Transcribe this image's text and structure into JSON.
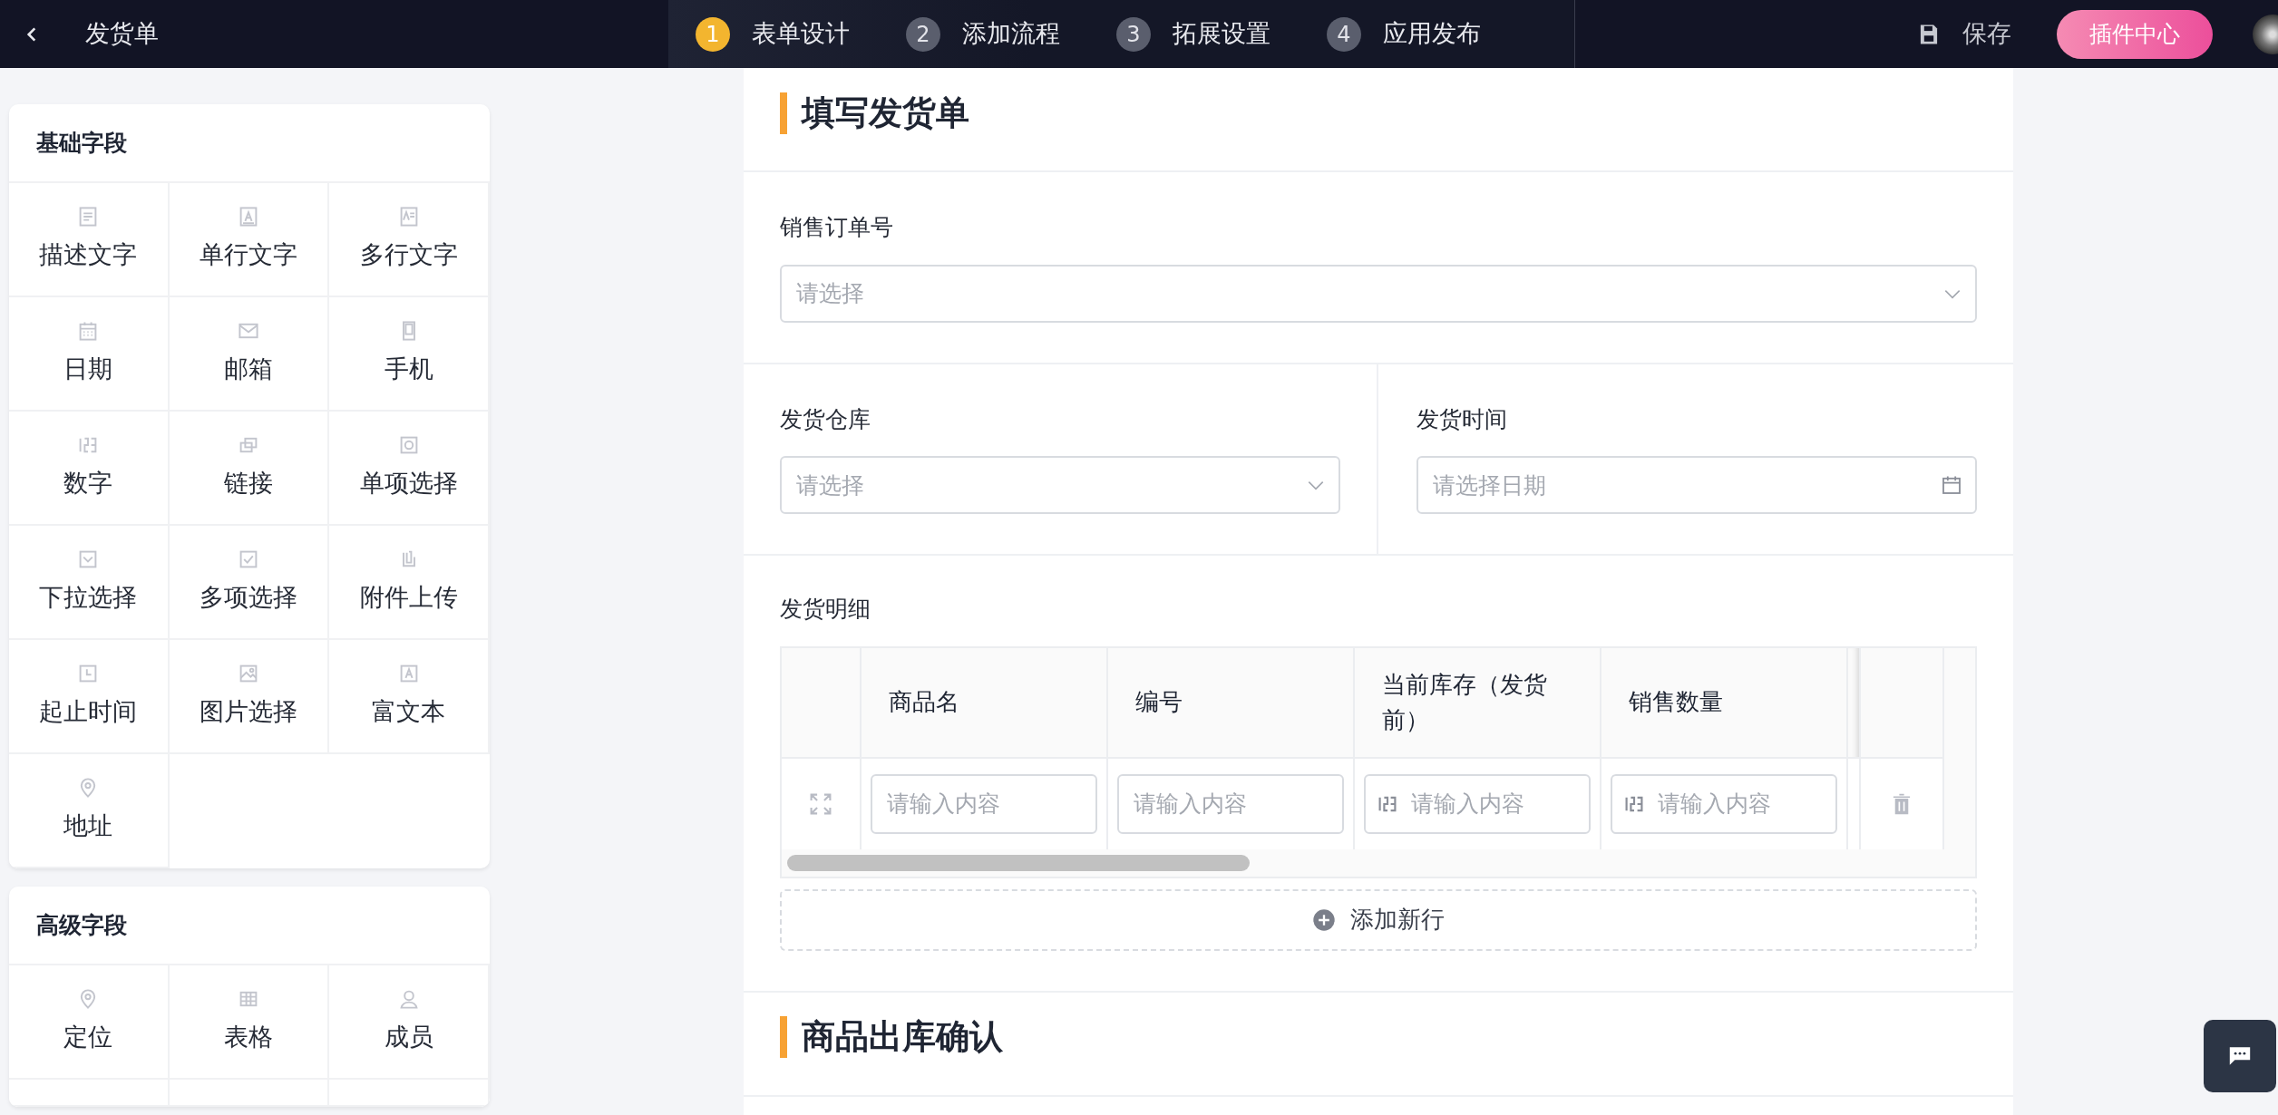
{
  "header": {
    "title": "发货单",
    "steps": [
      {
        "number": "1",
        "label": "表单设计",
        "selected": true
      },
      {
        "number": "2",
        "label": "添加流程",
        "selected": false
      },
      {
        "number": "3",
        "label": "拓展设置",
        "selected": false
      },
      {
        "number": "4",
        "label": "应用发布",
        "selected": false
      }
    ],
    "save": "保存",
    "plugin": "插件中心"
  },
  "palette": [
    {
      "title": "基础字段",
      "items": [
        "描述文字",
        "单行文字",
        "多行文字",
        "日期",
        "邮箱",
        "手机",
        "数字",
        "链接",
        "单项选择",
        "下拉选择",
        "多项选择",
        "附件上传",
        "起止时间",
        "图片选择",
        "富文本",
        "地址"
      ]
    },
    {
      "title": "高级字段",
      "items": [
        "定位",
        "表格",
        "成员"
      ]
    }
  ],
  "form": [
    {
      "kind": "title",
      "text": "填写发货单"
    },
    {
      "kind": "fields",
      "fields": [
        {
          "kind": "select",
          "label": "销售订单号",
          "placeholder": "请选择"
        }
      ]
    },
    {
      "kind": "fields",
      "fields": [
        {
          "kind": "select",
          "label": "发货仓库",
          "placeholder": "请选择"
        },
        {
          "kind": "date",
          "label": "发货时间",
          "placeholder": "请选择日期"
        }
      ]
    },
    {
      "kind": "table",
      "label": "发货明细",
      "columns": [
        {
          "title": "商品名",
          "kind": "text",
          "placeholder": "请输入内容"
        },
        {
          "title": "编号",
          "kind": "text",
          "placeholder": "请输入内容"
        },
        {
          "title": "当前库存（发货前）",
          "kind": "number",
          "placeholder": "请输入内容"
        },
        {
          "title": "销售数量",
          "kind": "number",
          "placeholder": "请输入内容"
        }
      ],
      "add_row": "添加新行"
    },
    {
      "kind": "title",
      "text": "商品出库确认"
    }
  ]
}
